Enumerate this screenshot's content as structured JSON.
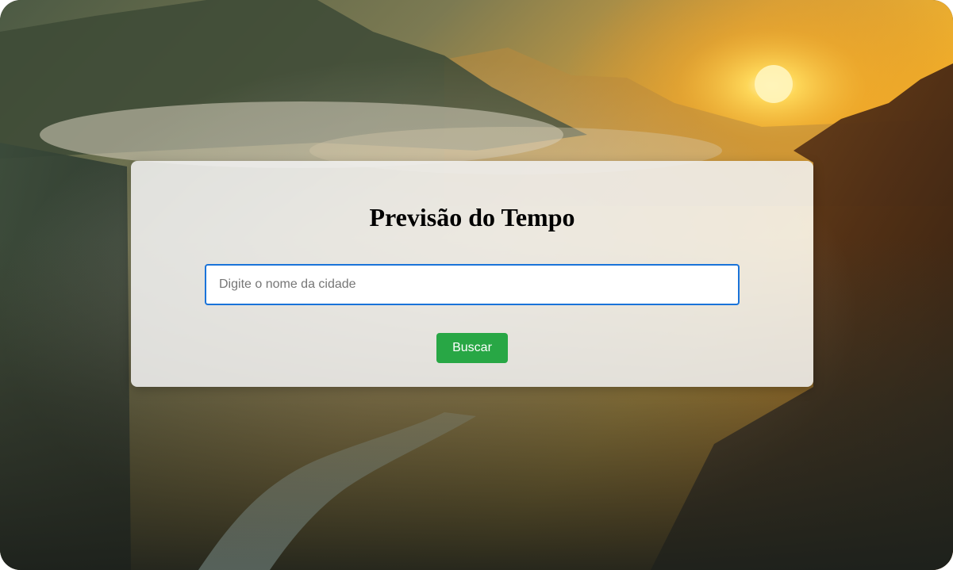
{
  "page": {
    "title": "Previsão do Tempo"
  },
  "search": {
    "value": "",
    "placeholder": "Digite o nome da cidade",
    "button_label": "Buscar"
  },
  "background": {
    "description_icon": "mountain-sunset-photo"
  },
  "colors": {
    "button_bg": "#28a745",
    "button_text": "#ffffff",
    "input_border_focus": "#1a73d9",
    "card_bg": "#f0f0f0",
    "title_text": "#000000"
  }
}
